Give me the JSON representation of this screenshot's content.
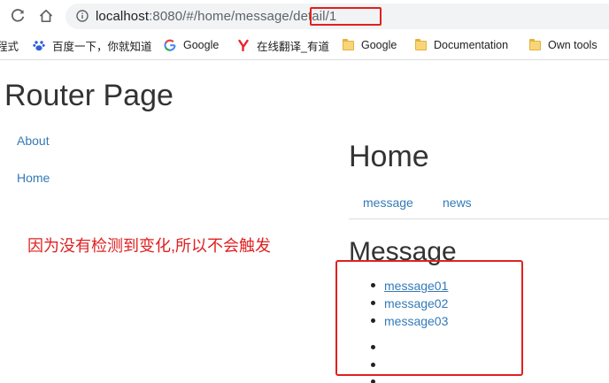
{
  "browser": {
    "url_host": "localhost",
    "url_path": ":8080/#/home/message/detail/1",
    "icons": [
      "reload-icon",
      "home-icon",
      "info-icon"
    ]
  },
  "bookmarks": [
    {
      "label": "程式",
      "icon": "none"
    },
    {
      "label": "百度一下，你就知道",
      "icon": "baidu-paw-icon"
    },
    {
      "label": "Google",
      "icon": "google-g-icon"
    },
    {
      "label": "在线翻译_有道",
      "icon": "youdao-icon"
    },
    {
      "label": "Google",
      "icon": "folder-icon"
    },
    {
      "label": "Documentation",
      "icon": "folder-icon"
    },
    {
      "label": "Own tools",
      "icon": "folder-icon"
    }
  ],
  "page": {
    "title": "Router Page",
    "side_links": [
      "About",
      "Home"
    ],
    "annotation": "因为没有检测到变化,所以不会触发"
  },
  "home": {
    "title": "Home",
    "tabs": [
      "message",
      "news"
    ]
  },
  "message": {
    "title": "Message",
    "items": [
      "message01",
      "message02",
      "message03"
    ]
  },
  "colors": {
    "link": "#337ab7",
    "annotation_red": "#e02020",
    "folder": "#f9d57a"
  }
}
